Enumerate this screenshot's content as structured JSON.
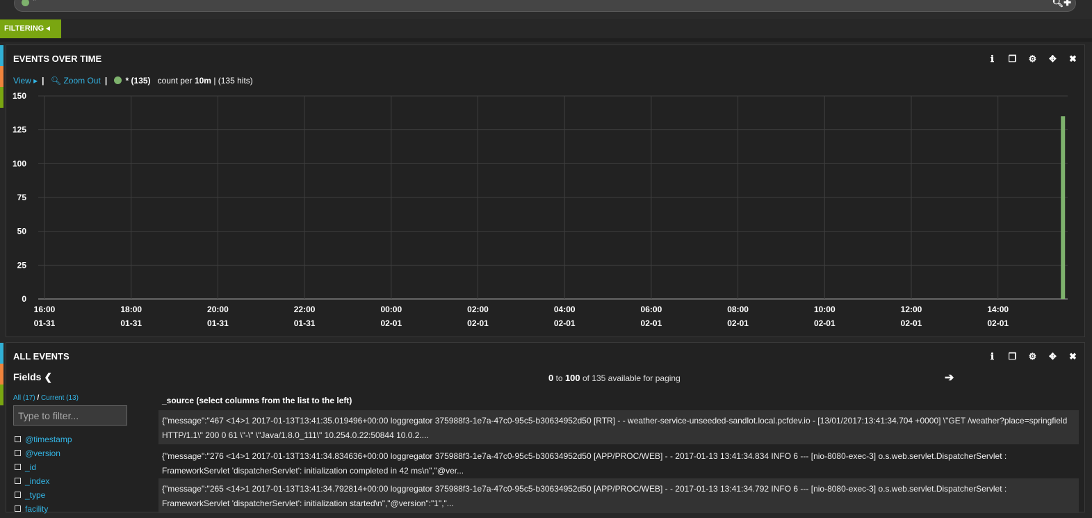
{
  "query": {
    "value": "*"
  },
  "filtering_tab": {
    "label": "FILTERING",
    "icon": "caret-left-icon"
  },
  "histogram": {
    "title": "EVENTS OVER TIME",
    "toolbar": {
      "view_label": "View",
      "zoom_label": "Zoom Out",
      "series_label": "* (135)",
      "count_prefix": "count per ",
      "interval": "10m",
      "hits": "| (135 hits)"
    },
    "series_color": "#7eb26d"
  },
  "chart_data": {
    "type": "bar",
    "title": "EVENTS OVER TIME",
    "xlabel": "",
    "ylabel": "",
    "ylim": [
      0,
      150
    ],
    "yticks": [
      0,
      25,
      50,
      75,
      100,
      125,
      150
    ],
    "xticks": [
      {
        "time": "16:00",
        "date": "01-31"
      },
      {
        "time": "18:00",
        "date": "01-31"
      },
      {
        "time": "20:00",
        "date": "01-31"
      },
      {
        "time": "22:00",
        "date": "01-31"
      },
      {
        "time": "00:00",
        "date": "02-01"
      },
      {
        "time": "02:00",
        "date": "02-01"
      },
      {
        "time": "04:00",
        "date": "02-01"
      },
      {
        "time": "06:00",
        "date": "02-01"
      },
      {
        "time": "08:00",
        "date": "02-01"
      },
      {
        "time": "10:00",
        "date": "02-01"
      },
      {
        "time": "12:00",
        "date": "02-01"
      },
      {
        "time": "14:00",
        "date": "02-01"
      }
    ],
    "xrange_hours": [
      15.9,
      15.6
    ],
    "series": [
      {
        "name": "* (135)",
        "color": "#7eb26d",
        "points": [
          {
            "x": "02-01 15:30",
            "value": 135
          }
        ]
      }
    ],
    "grid": true,
    "legend": "top-left"
  },
  "events": {
    "title": "ALL EVENTS",
    "fields": {
      "title": "Fields",
      "all_label": "All (17)",
      "current_label": "Current (13)",
      "filter_placeholder": "Type to filter...",
      "items": [
        "@timestamp",
        "@version",
        "_id",
        "_index",
        "_type",
        "facility"
      ]
    },
    "paging": {
      "from": "0",
      "to_word": "to",
      "to": "100",
      "suffix": "of 135 available for paging"
    },
    "column_header": "_source (select columns from the list to the left)",
    "rows": [
      "{\"message\":\"467 <14>1 2017-01-13T13:41:35.019496+00:00 loggregator 375988f3-1e7a-47c0-95c5-b30634952d50 [RTR] - - weather-service-unseeded-sandlot.local.pcfdev.io - [13/01/2017:13:41:34.704 +0000] \\\"GET /weather?place=springfield HTTP/1.1\\\" 200 0 61 \\\"-\\\" \\\"Java/1.8.0_111\\\" 10.254.0.22:50844 10.0.2....",
      "{\"message\":\"276 <14>1 2017-01-13T13:41:34.834636+00:00 loggregator 375988f3-1e7a-47c0-95c5-b30634952d50 [APP/PROC/WEB] - - 2017-01-13 13:41:34.834 INFO 6 --- [nio-8080-exec-3] o.s.web.servlet.DispatcherServlet : FrameworkServlet 'dispatcherServlet': initialization completed in 42 ms\\n\",\"@ver...",
      "{\"message\":\"265 <14>1 2017-01-13T13:41:34.792814+00:00 loggregator 375988f3-1e7a-47c0-95c5-b30634952d50 [APP/PROC/WEB] - - 2017-01-13 13:41:34.792 INFO 6 --- [nio-8080-exec-3] o.s.web.servlet.DispatcherServlet : FrameworkServlet 'dispatcherServlet': initialization started\\n\",\"@version\":\"1\",\"..."
    ]
  },
  "colors": {
    "accent": "#33b5e5",
    "filter_green": "#7aa611",
    "side_blue": "#31b0d5",
    "side_orange": "#ef843c",
    "side_green": "#7aa611"
  }
}
